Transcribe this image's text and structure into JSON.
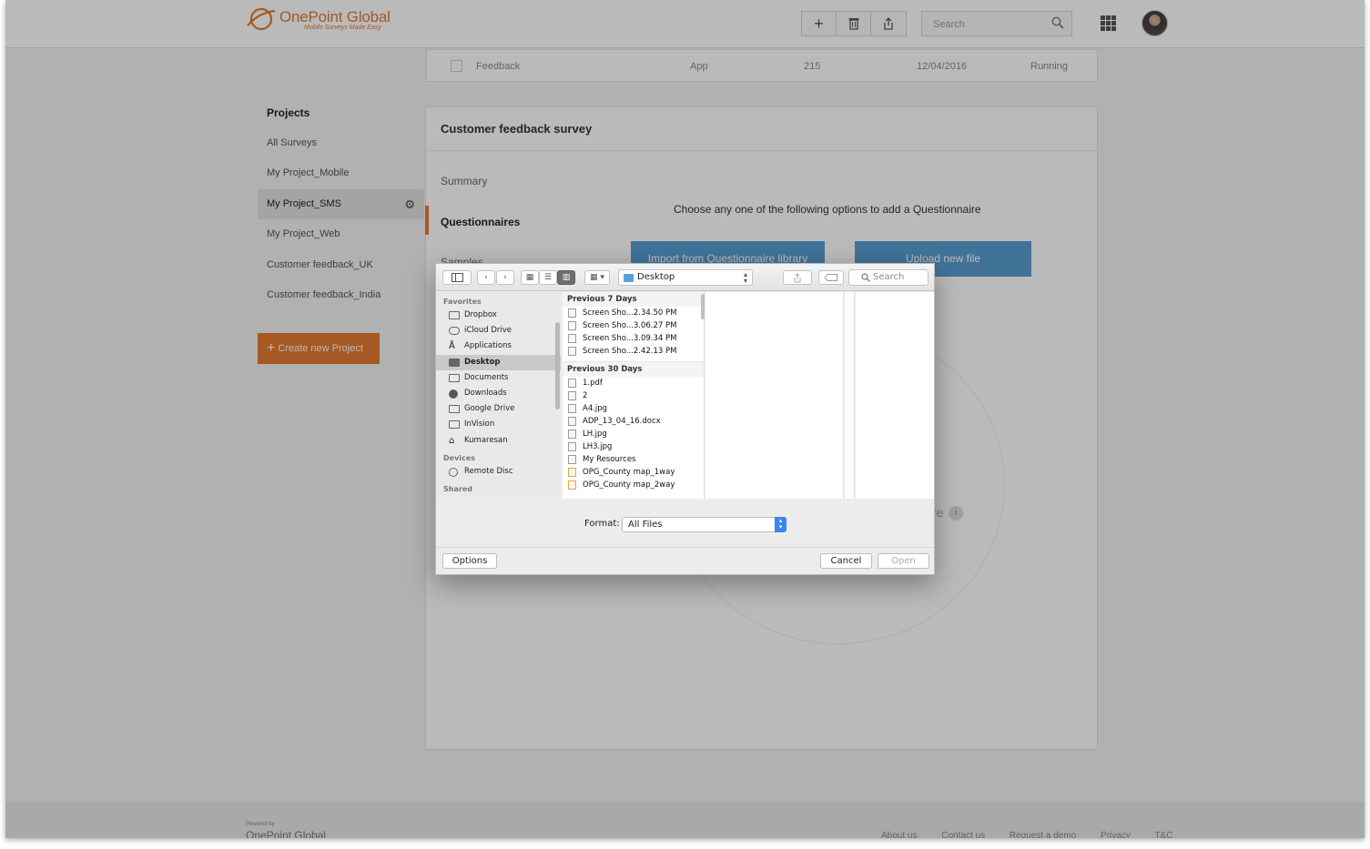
{
  "brand": {
    "name": "OnePoint Global",
    "tagline": "Mobile Surveys Made Easy"
  },
  "header": {
    "search_placeholder": "Search",
    "icons": [
      "plus-icon",
      "trash-icon",
      "share-icon",
      "search-icon",
      "apps-grid-icon",
      "avatar"
    ]
  },
  "previous_row": {
    "name": "Feedback",
    "type": "App",
    "count": "215",
    "date": "12/04/2016",
    "status": "Running"
  },
  "sidebar": {
    "title": "Projects",
    "items": [
      {
        "label": "All Surveys",
        "active": false
      },
      {
        "label": "My Project_Mobile",
        "active": false
      },
      {
        "label": "My Project_SMS",
        "active": true
      },
      {
        "label": "My Project_Web",
        "active": false
      },
      {
        "label": "Customer feedback_UK",
        "active": false
      },
      {
        "label": "Customer feedback_India",
        "active": false
      }
    ],
    "create_button": "Create new Project"
  },
  "card": {
    "title": "Customer feedback survey",
    "tabs": [
      "Summary",
      "Questionnaires",
      "Samples"
    ],
    "active_tab": "Questionnaires",
    "instruction": "Choose any one of the following options to add a Questionnaire",
    "import_button": "Import from Questionnaire library",
    "upload_button": "Upload new file",
    "ghost_text": "re"
  },
  "footer": {
    "powered_by": "Powered by",
    "logo": "OnePoint Global",
    "links": [
      "About us",
      "Contact us",
      "Request a demo",
      "Privacy",
      "T&C"
    ]
  },
  "dialog": {
    "location": "Desktop",
    "search_placeholder": "Search",
    "favorites_label": "Favorites",
    "favorites": [
      "Dropbox",
      "iCloud Drive",
      "Applications",
      "Desktop",
      "Documents",
      "Downloads",
      "Google Drive",
      "InVision",
      "Kumaresan"
    ],
    "selected_favorite": "Desktop",
    "devices_label": "Devices",
    "devices": [
      "Remote Disc"
    ],
    "shared_label": "Shared",
    "group1": {
      "label": "Previous 7 Days",
      "files": [
        "Screen Sho...2.34.50 PM",
        "Screen Sho...3.06.27 PM",
        "Screen Sho...3.09.34 PM",
        "Screen Sho...2.42.13 PM"
      ]
    },
    "group2": {
      "label": "Previous 30 Days",
      "files": [
        "1.pdf",
        "2",
        "A4.jpg",
        "ADP_13_04_16.docx",
        "LH.jpg",
        "LH3.jpg",
        "My Resources",
        "OPG_County map_1way",
        "OPG_County map_2way"
      ]
    },
    "format_label": "Format:",
    "format_value": "All Files",
    "options_button": "Options",
    "cancel_button": "Cancel",
    "open_button": "Open"
  },
  "colors": {
    "accent": "#e47a2f",
    "blue_button": "#5a9ed2",
    "select_blue": "#3c84f0"
  }
}
